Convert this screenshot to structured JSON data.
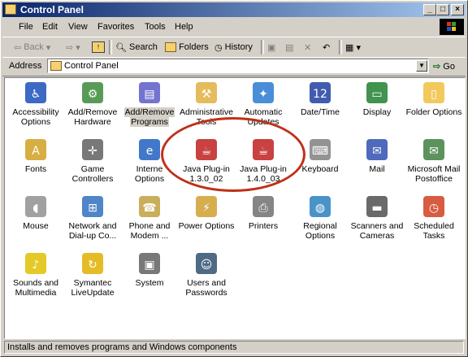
{
  "window": {
    "title": "Control Panel"
  },
  "menu": [
    "File",
    "Edit",
    "View",
    "Favorites",
    "Tools",
    "Help"
  ],
  "toolbar": {
    "back": "Back",
    "forward": "",
    "up": "",
    "search": "Search",
    "folders": "Folders",
    "history": "History"
  },
  "address": {
    "label": "Address",
    "value": "Control Panel",
    "go": "Go"
  },
  "items": [
    {
      "label1": "Accessibility",
      "label2": "Options",
      "icon": "accessibility-icon"
    },
    {
      "label1": "Add/Remove",
      "label2": "Hardware",
      "icon": "hardware-icon"
    },
    {
      "label1": "Add/Remove",
      "label2": "Programs",
      "icon": "programs-icon"
    },
    {
      "label1": "Administrative",
      "label2": "Tools",
      "icon": "admin-tools-icon"
    },
    {
      "label1": "Automatic",
      "label2": "Updates",
      "icon": "updates-icon"
    },
    {
      "label1": "Date/Time",
      "label2": "",
      "icon": "calendar-icon"
    },
    {
      "label1": "Display",
      "label2": "",
      "icon": "display-icon"
    },
    {
      "label1": "Folder Options",
      "label2": "",
      "icon": "folder-icon"
    },
    {
      "label1": "Fonts",
      "label2": "",
      "icon": "fonts-icon"
    },
    {
      "label1": "Game",
      "label2": "Controllers",
      "icon": "joystick-icon"
    },
    {
      "label1": "Interne",
      "label2": "Options",
      "icon": "internet-icon"
    },
    {
      "label1": "Java Plug-in",
      "label2": "1.3.0_02",
      "icon": "java-icon"
    },
    {
      "label1": "Java Plug-in",
      "label2": "1.4.0_03",
      "icon": "java-icon"
    },
    {
      "label1": "Keyboard",
      "label2": "",
      "icon": "keyboard-icon"
    },
    {
      "label1": "Mail",
      "label2": "",
      "icon": "mail-icon"
    },
    {
      "label1": "Microsoft Mail",
      "label2": "Postoffice",
      "icon": "postoffice-icon"
    },
    {
      "label1": "Mouse",
      "label2": "",
      "icon": "mouse-icon"
    },
    {
      "label1": "Network and",
      "label2": "Dial-up Co...",
      "icon": "network-icon"
    },
    {
      "label1": "Phone and",
      "label2": "Modem ...",
      "icon": "phone-icon"
    },
    {
      "label1": "Power Options",
      "label2": "",
      "icon": "power-icon"
    },
    {
      "label1": "Printers",
      "label2": "",
      "icon": "printer-icon"
    },
    {
      "label1": "Regional",
      "label2": "Options",
      "icon": "globe-icon"
    },
    {
      "label1": "Scanners and",
      "label2": "Cameras",
      "icon": "scanner-icon"
    },
    {
      "label1": "Scheduled",
      "label2": "Tasks",
      "icon": "tasks-icon"
    },
    {
      "label1": "Sounds and",
      "label2": "Multimedia",
      "icon": "speaker-icon"
    },
    {
      "label1": "Symantec",
      "label2": "LiveUpdate",
      "icon": "symantec-icon"
    },
    {
      "label1": "System",
      "label2": "",
      "icon": "computer-icon"
    },
    {
      "label1": "Users and",
      "label2": "Passwords",
      "icon": "users-icon"
    }
  ],
  "status": "Installs and removes programs and Windows components"
}
